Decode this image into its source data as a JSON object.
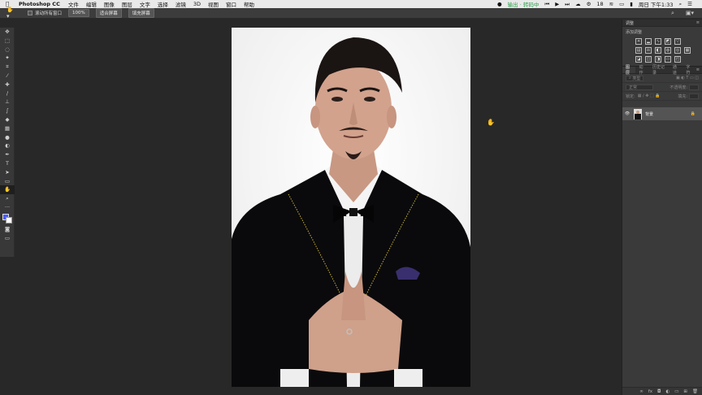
{
  "menubar": {
    "apple_icon": "apple-logo-icon",
    "app_name": "Photoshop CC",
    "menus": [
      "文件",
      "编辑",
      "图像",
      "图层",
      "文字",
      "选择",
      "滤镜",
      "3D",
      "视图",
      "窗口",
      "帮助"
    ],
    "status_text": "输出 · 转码中",
    "battery_percent": "18",
    "clock": "周日 下午1:33"
  },
  "options": {
    "scroll_all_label": "滚动所有窗口",
    "zoom_value": "100%",
    "fit_screen_label": "适合屏幕",
    "fill_screen_label": "填充屏幕"
  },
  "panels": {
    "adjust_header": "调整",
    "add_adjust_label": "添加调整",
    "layer_tabs": [
      "图层",
      "动作",
      "历史记录",
      "通道",
      "字符"
    ],
    "kind_label": "类型",
    "blend_mode": "正常",
    "opacity_label": "不透明度:",
    "lock_label": "锁定:",
    "fill_label": "填充:",
    "layer_name": "背景"
  },
  "colors": {
    "foreground": "#4a5cff",
    "background": "#ffffff"
  }
}
